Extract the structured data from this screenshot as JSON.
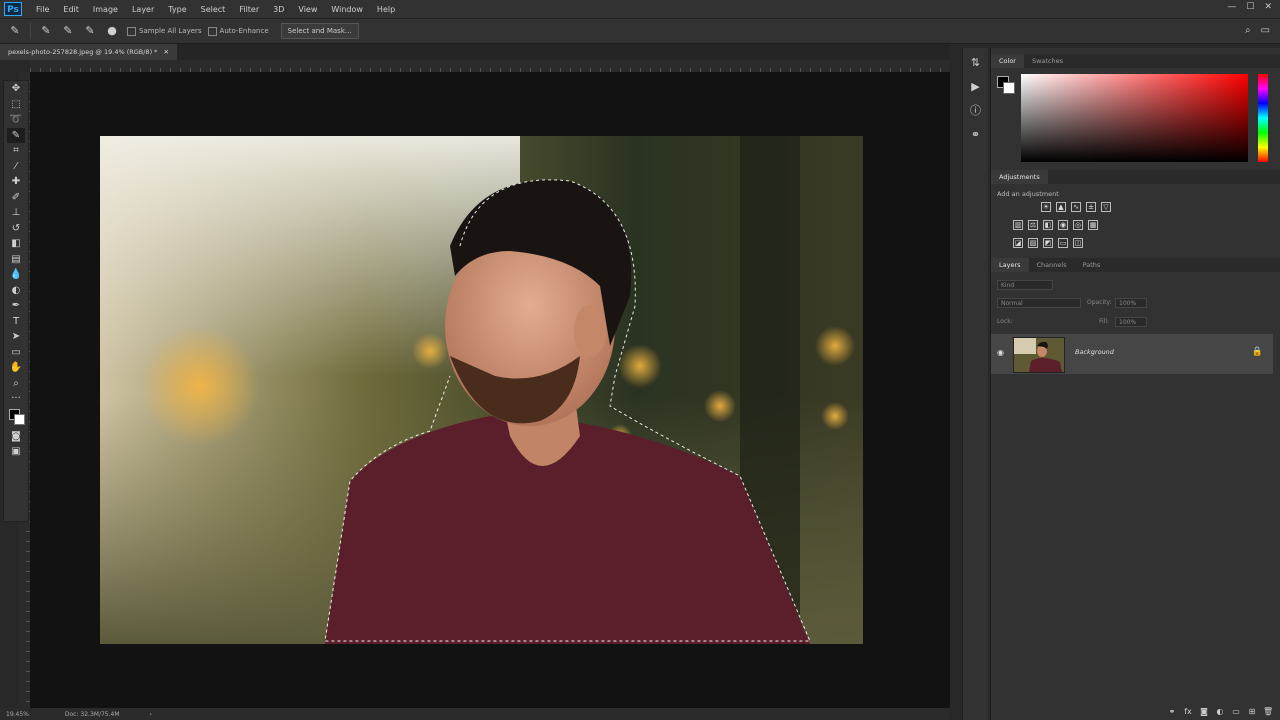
{
  "app": {
    "logo": "Ps"
  },
  "menu": [
    "File",
    "Edit",
    "Image",
    "Layer",
    "Type",
    "Select",
    "Filter",
    "3D",
    "View",
    "Window",
    "Help"
  ],
  "options_bar": {
    "sample_all_layers": "Sample All Layers",
    "auto_enhance": "Auto-Enhance",
    "select_and_mask": "Select and Mask..."
  },
  "document_tab": "pexels-photo-257828.jpeg @ 19.4% (RGB/8) *",
  "status_bar": {
    "zoom": "19.45%",
    "doc": "Doc: 32.3M/75.4M"
  },
  "panels": {
    "color_tabs": [
      "Color",
      "Swatches"
    ],
    "adjustments_title": "Adjustments",
    "adjustments_subtitle": "Add an adjustment",
    "layers_tabs": [
      "Layers",
      "Channels",
      "Paths"
    ],
    "kind_label": "Kind",
    "blend_mode": "Normal",
    "opacity_label": "Opacity:",
    "opacity_value": "100%",
    "lock_label": "Lock:",
    "fill_label": "Fill:",
    "fill_value": "100%",
    "layer_name": "Background"
  },
  "colors": {
    "accent": "#31a8ff",
    "panel_bg": "#323232",
    "canvas_bg": "#121212",
    "shirt": "#5a1f2a"
  }
}
